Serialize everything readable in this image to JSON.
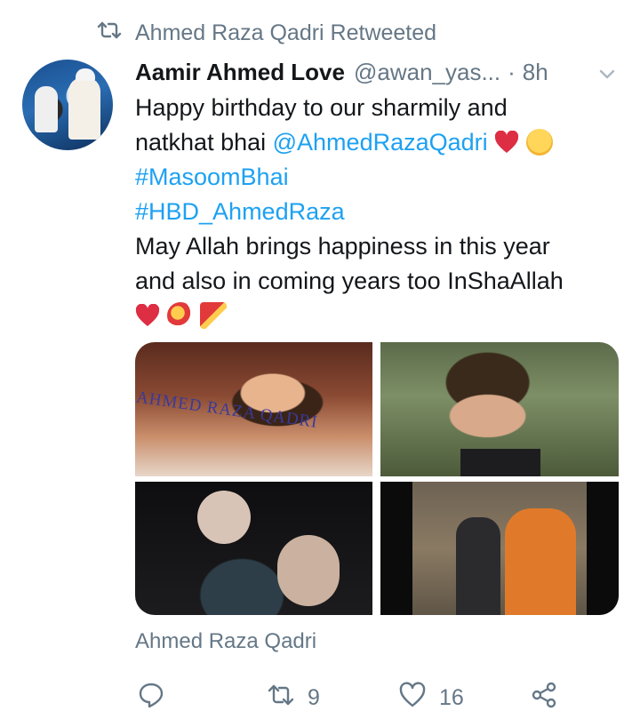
{
  "retweet_context": {
    "label": "Ahmed Raza Qadri Retweeted"
  },
  "tweet": {
    "author_name": "Aamir Ahmed Love",
    "author_handle": "@awan_yas...",
    "separator": "·",
    "time": "8h",
    "text": {
      "line1": "Happy birthday to our sharmily and",
      "line2_prefix": "natkhat bhai ",
      "mention": "@AhmedRazaQadri",
      "hashtag1": "#MasoomBhai",
      "hashtag2": "#HBD_AhmedRaza",
      "line5": "May Allah brings happiness in this year",
      "line6": "and also in coming years too InShaAllah"
    },
    "images": {
      "watermark": "AHMED RAZA QADRI"
    },
    "tagged": "Ahmed Raza Qadri",
    "actions": {
      "reply_count": "",
      "retweet_count": "9",
      "like_count": "16"
    }
  },
  "colors": {
    "link": "#1da1f2",
    "muted": "#657786",
    "heart": "#e0245e"
  },
  "icons": [
    "retweet-icon",
    "chevron-down-icon",
    "reply-icon",
    "retweet-icon",
    "like-icon",
    "share-icon"
  ]
}
